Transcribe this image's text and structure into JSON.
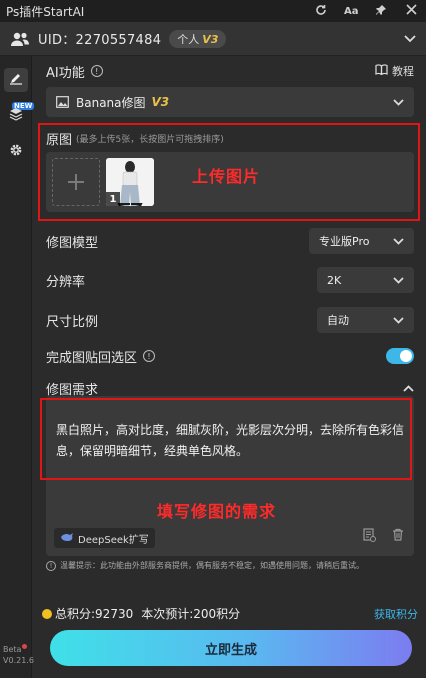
{
  "titlebar": {
    "title": "Ps插件StartAI",
    "icons": [
      "refresh-icon",
      "text-size-icon",
      "pin-icon",
      "close-icon"
    ],
    "text_size_label": "Aa"
  },
  "account": {
    "uid": "UID：2270557484",
    "plan": "个人",
    "level": "V3"
  },
  "sidebar": {
    "new_badge": "NEW",
    "version": "Beta",
    "version_number": "V0.21.6"
  },
  "ai_function": {
    "label": "AI功能",
    "tutorial": "教程",
    "selected": "Banana修图",
    "version": "V3"
  },
  "original": {
    "label": "原图",
    "hint": "(最多上传5张，长按图片可拖拽排序)",
    "thumb_index": "1",
    "annotation": "上传图片"
  },
  "model": {
    "label": "修图模型",
    "value": "专业版Pro"
  },
  "resolution": {
    "label": "分辨率",
    "value": "2K"
  },
  "ratio": {
    "label": "尺寸比例",
    "value": "自动"
  },
  "paste": {
    "label": "完成图贴回选区",
    "enabled": true
  },
  "prompt": {
    "label": "修图需求",
    "text": "黑白照片，高对比度，细腻灰阶，光影层次分明，去除所有色彩信息，保留明暗细节，经典单色风格。",
    "annotation": "填写修图的需求",
    "deepseek": "DeepSeek扩写"
  },
  "notice": "温馨提示：此功能由外部服务商提供，偶有服务不稳定，如遇使用问题，请稍后重试。",
  "points": {
    "total": "总积分:92730",
    "estimate": "本次预计:200积分",
    "get": "获取积分"
  },
  "generate": {
    "label": "立即生成"
  },
  "colors": {
    "accent": "#3cb7e8",
    "annotation_red": "#e01515",
    "gold": "#e8c14a"
  }
}
